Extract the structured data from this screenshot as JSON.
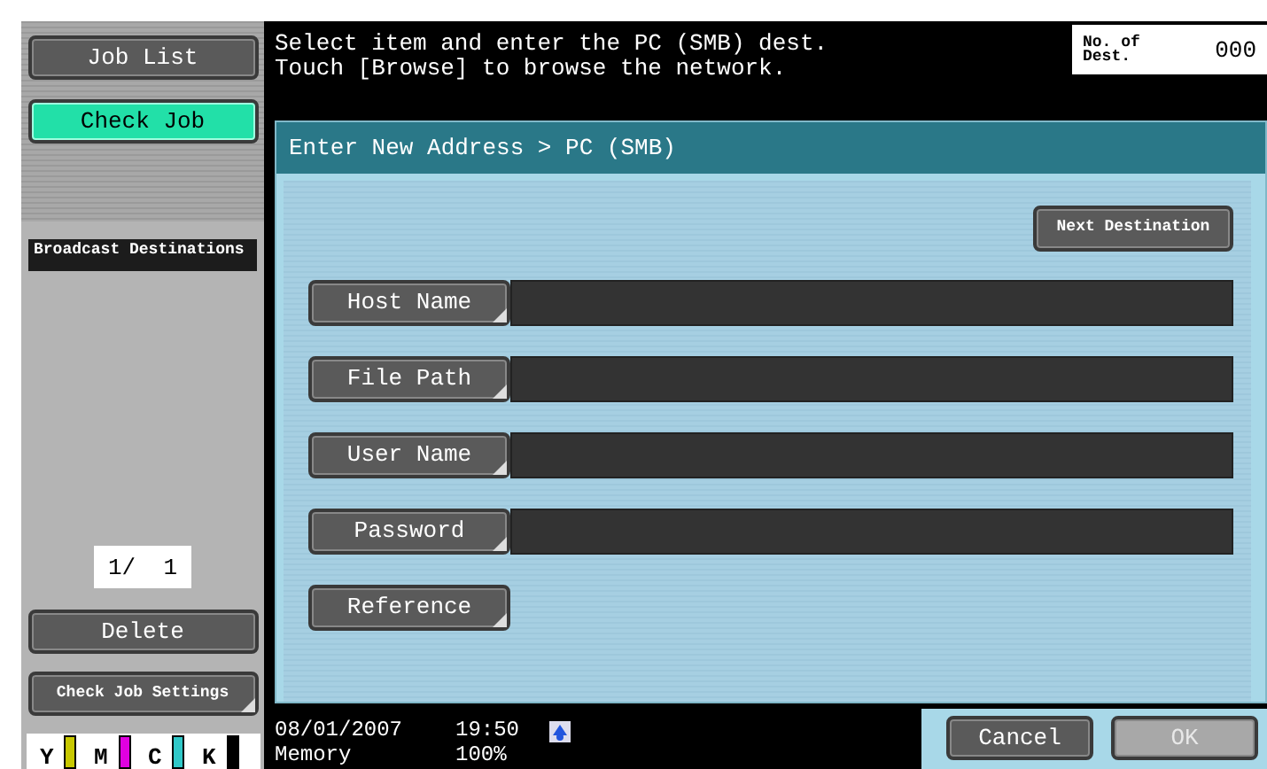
{
  "sidebar": {
    "buttons": [
      {
        "label": "Job List",
        "selected": false
      },
      {
        "label": "Check Job",
        "selected": true
      }
    ],
    "section_label": "Broadcast Destinations",
    "page_counter": "1/  1",
    "delete_button": "Delete",
    "settings_button": "Check Job Settings",
    "toner": [
      {
        "label": "Y",
        "color": "#c8c800"
      },
      {
        "label": "M",
        "color": "#e000e0"
      },
      {
        "label": "C",
        "color": "#30c8c8"
      },
      {
        "label": "K",
        "color": "#000000"
      }
    ]
  },
  "message": [
    "Select item and enter the PC (SMB) dest.",
    "Touch [Browse] to browse the network."
  ],
  "dest_count": {
    "label": "No. of Dest.",
    "value": "000"
  },
  "breadcrumb": "Enter New Address > PC (SMB)",
  "next_button": "Next Destination",
  "fields": [
    {
      "label": "Host Name",
      "kind": "input"
    },
    {
      "label": "File Path",
      "kind": "input"
    },
    {
      "label": "User Name",
      "kind": "input"
    },
    {
      "label": "Password",
      "kind": "input"
    },
    {
      "label": "Reference",
      "kind": "button"
    }
  ],
  "status": {
    "date": "08/01/2007",
    "time": "19:50",
    "memory_label": "Memory",
    "memory": "100%"
  },
  "actions": [
    {
      "label": "Cancel",
      "disabled": false
    },
    {
      "label": "OK",
      "disabled": true
    }
  ]
}
